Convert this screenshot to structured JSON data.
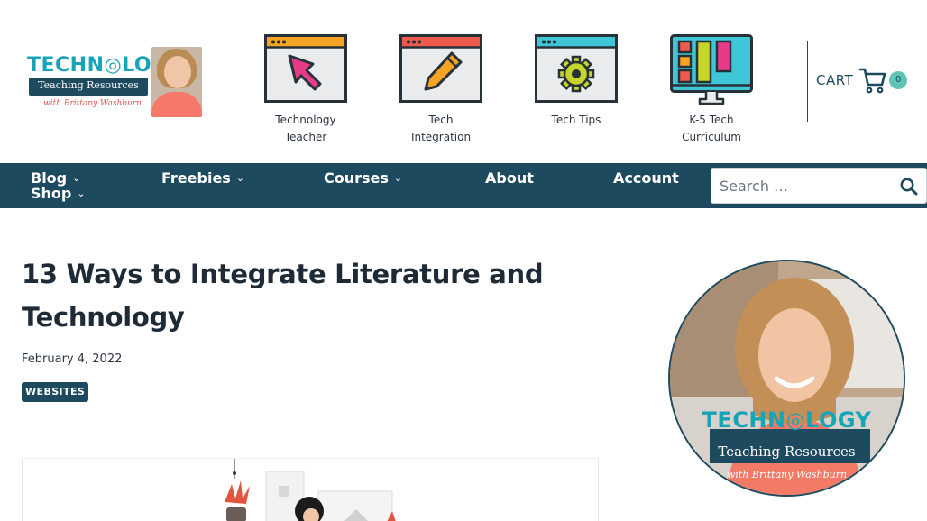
{
  "logo": {
    "title": "TECHN◎LOGY",
    "subtitle": "Teaching Resources",
    "script": "with Brittany Washburn"
  },
  "header_nav": [
    {
      "label_line1": "Technology",
      "label_line2": "Teacher",
      "icon": "cursor-arrow-icon"
    },
    {
      "label_line1": "Tech",
      "label_line2": "Integration",
      "icon": "pencil-icon"
    },
    {
      "label_line1": "Tech Tips",
      "label_line2": "",
      "icon": "gear-icon"
    },
    {
      "label_line1": "K-5 Tech",
      "label_line2": "Curriculum",
      "icon": "monitor-icon"
    }
  ],
  "cart": {
    "label": "CART",
    "count": "0",
    "icon": "shopping-cart-icon"
  },
  "nav": {
    "blog": "Blog",
    "shop": "Shop",
    "freebies": "Freebies",
    "courses": "Courses",
    "about": "About",
    "account": "Account",
    "chevron": "⌄"
  },
  "search": {
    "placeholder": "Search …",
    "icon": "search-icon"
  },
  "post": {
    "title": "13 Ways to Integrate Literature and Technology",
    "date": "February 4, 2022",
    "category": "WEBSITES"
  },
  "sidebar": {
    "avatar_title": "TECHN◎LOGY",
    "avatar_subtitle": "Teaching Resources",
    "avatar_script": "with Brittany Washburn"
  },
  "colors": {
    "navy": "#1e4a5f",
    "teal": "#18a4b8",
    "mint": "#5fc4b4",
    "coral": "#f4796b"
  }
}
